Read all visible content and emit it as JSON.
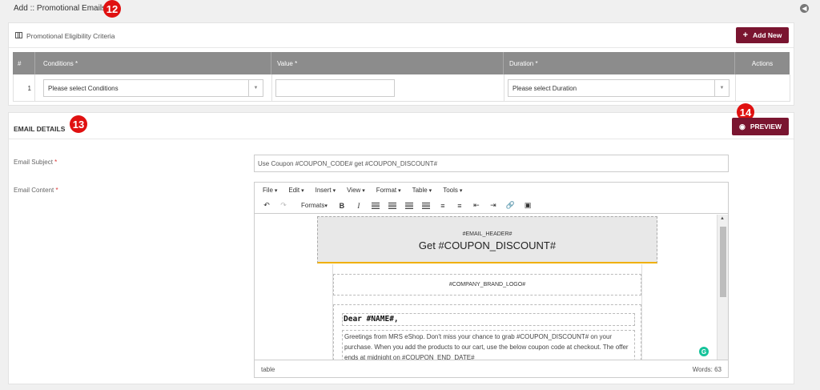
{
  "page": {
    "title": "Add :: Promotional Emails",
    "badges": {
      "a": "12",
      "b": "13",
      "c": "14"
    }
  },
  "eligibility": {
    "title": "Promotional Eligibility Criteria",
    "add_new_label": "Add New",
    "columns": [
      "#",
      "Conditions *",
      "Value *",
      "Duration *",
      "Actions"
    ],
    "rows": [
      {
        "index": "1",
        "conditions_placeholder": "Please select Conditions",
        "value": "",
        "duration_placeholder": "Please select Duration"
      }
    ]
  },
  "email_details": {
    "title": "EMAIL DETAILS",
    "preview_label": "PREVIEW",
    "subject_label": "Email Subject",
    "subject_value": "Use Coupon #COUPON_CODE# get #COUPON_DISCOUNT#",
    "content_label": "Email Content",
    "required_mark": "*"
  },
  "editor": {
    "menus": [
      "File",
      "Edit",
      "Insert",
      "View",
      "Format",
      "Table",
      "Tools"
    ],
    "formats_label": "Formats",
    "email_header_tag": "#EMAIL_HEADER#",
    "email_title": "Get #COUPON_DISCOUNT#",
    "brand_logo_tag": "#COMPANY_BRAND_LOGO#",
    "greeting": "Dear #NAME#,",
    "body_text": "Greetings from MRS eShop. Don't miss your chance to grab #COUPON_DISCOUNT# on your purchase. When you add the products to our cart, use the below coupon code at checkout. The offer ends at midnight on #COUPON_END_DATE#",
    "status_path": "table",
    "word_count": "Words: 63"
  },
  "icons": [
    "back-icon",
    "list-icon",
    "plus-icon",
    "eye-icon",
    "undo-icon",
    "redo-icon",
    "bold-icon",
    "italic-icon",
    "align-left-icon",
    "align-center-icon",
    "align-right-icon",
    "align-justify-icon",
    "bullet-list-icon",
    "numbered-list-icon",
    "outdent-icon",
    "indent-icon",
    "link-icon",
    "image-icon",
    "grammarly-icon"
  ],
  "colors": {
    "accent": "#7a1530",
    "badge": "#e01010",
    "table_header": "#8c8c8c"
  }
}
